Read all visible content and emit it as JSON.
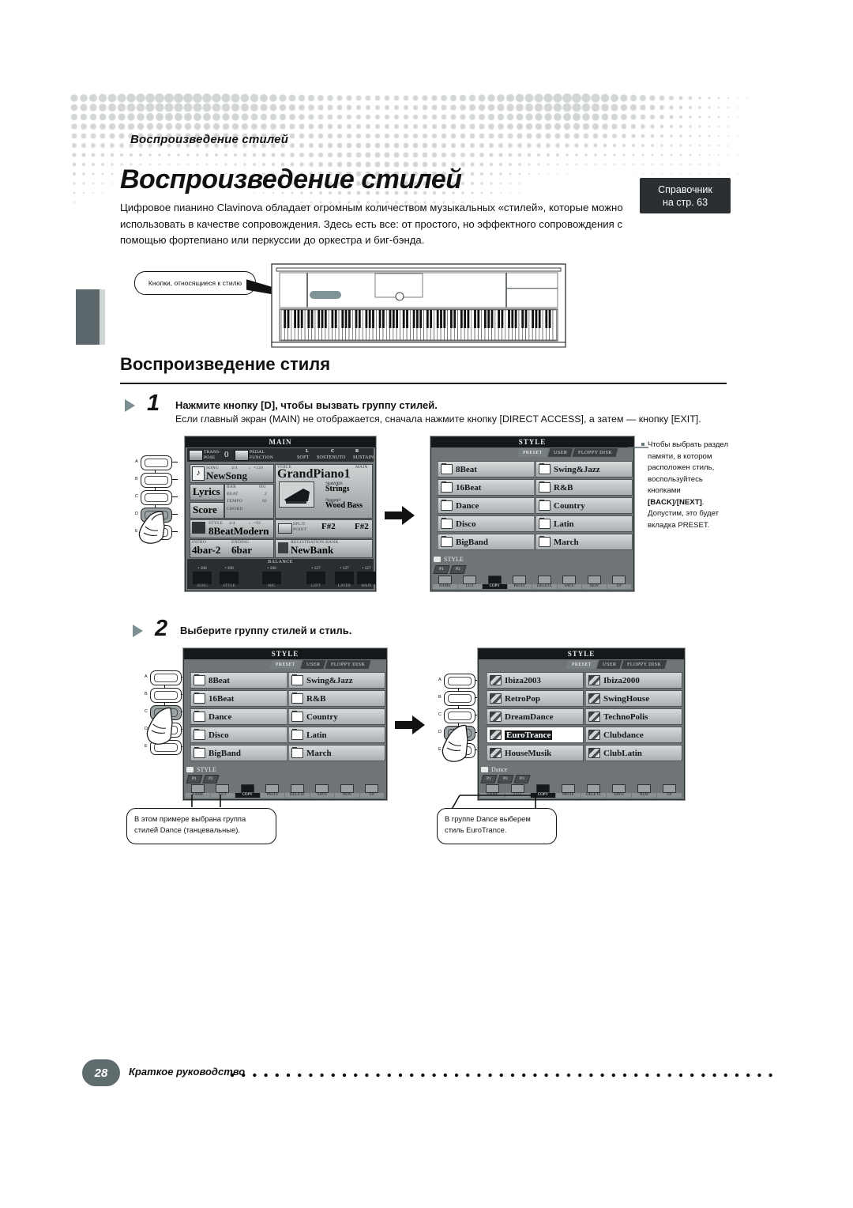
{
  "header": {
    "running_head": "Воспроизведение стилей",
    "title": "Воспроизведение стилей",
    "reference_line1": "Справочник",
    "reference_line2": "на стр. 63",
    "intro": "Цифровое пианино Clavinova обладает огромным количеством музыкальных «стилей», которые можно использовать в качестве сопровождения. Здесь есть все: от простого, но эффектного сопровождения с помощью фортепиано или перкуссии до оркестра и биг-бэнда."
  },
  "piano_callout": "Кнопки, относящиеся к стилю",
  "section_title": "Воспроизведение стиля",
  "steps": [
    {
      "number": "1",
      "title": "Нажмите кнопку [D], чтобы вызвать группу стилей.",
      "subtitle": "Если главный экран (MAIN) не отображается, сначала нажмите кнопку [DIRECT ACCESS], а затем — кнопку [EXIT]."
    },
    {
      "number": "2",
      "title": "Выберите группу стилей и стиль."
    }
  ],
  "main_screen": {
    "title": "MAIN",
    "transpose_label1": "TRANS-",
    "transpose_label2": "POSE",
    "transpose_value": "0",
    "pedal_label1": "PEDAL",
    "pedal_label2": "FUNCTION",
    "pedal_l": "L",
    "pedal_c": "C",
    "pedal_r": "R",
    "pedal_soft": "SOFT",
    "pedal_sostenuto": "SOSTENUTO",
    "pedal_sustain": "SUSTAIN",
    "song_label": "SONG",
    "song_meter": "4/4",
    "song_tempo": "♩=120",
    "song_name": "NewSong",
    "lyrics_button": "Lyrics",
    "score_button": "Score",
    "bar_label": "BAR",
    "bar_value": "001",
    "beat_label": "BEAT",
    "beat_value": "2",
    "tempo_label": "TEMPO",
    "tempo_value": "92",
    "chord_label": "CHORD",
    "style_label": "STYLE",
    "style_meter": "4/4",
    "style_tempo": "♩=92",
    "style_name": "8BeatModern",
    "intro_label": "INTRO",
    "intro_value": "4bar-2",
    "ending_label": "ENDING",
    "ending_value": "6bar",
    "voice_label": "VOICE",
    "main_label": "MAIN",
    "main_voice": "GrandPiano1",
    "layer_label": "LAYER",
    "layer_pre": "Natural!",
    "layer_voice": "Strings",
    "left_label": "LEFT",
    "left_pre": "Natural!",
    "left_voice": "Wood Bass",
    "split_label1": "SPLIT",
    "split_label2": "POINT",
    "split_left": "F#2",
    "split_right": "F#2",
    "regist_label": "REGISTRATION BANK",
    "regist_value": "NewBank",
    "balance_label": "BALANCE",
    "balance": [
      {
        "name": "SONG",
        "value": "100"
      },
      {
        "name": "STYLE",
        "value": "100"
      },
      {
        "name": "MIC",
        "value": "100"
      },
      {
        "name": "LEFT",
        "value": "127"
      },
      {
        "name": "LAYER",
        "value": "127"
      },
      {
        "name": "MAIN",
        "value": "127"
      }
    ]
  },
  "style_screen_groups": {
    "title": "STYLE",
    "tabs": [
      "PRESET",
      "USER",
      "FLOPPY DISK"
    ],
    "active_tab": "PRESET",
    "items_left": [
      "8Beat",
      "16Beat",
      "Dance",
      "Disco",
      "BigBand"
    ],
    "items_right": [
      "Swing&Jazz",
      "R&B",
      "Country",
      "Latin",
      "March"
    ],
    "folder": "STYLE",
    "page_tabs": [
      "P1",
      "P2"
    ],
    "soft_buttons": [
      "NAME",
      "CUT",
      "COPY",
      "PASTE",
      "DELETE",
      "SAVE",
      "NEW",
      "UP"
    ],
    "active_soft": "COPY"
  },
  "style_screen_dance": {
    "title": "STYLE",
    "tabs": [
      "PRESET",
      "USER",
      "FLOPPY DISK"
    ],
    "active_tab": "PRESET",
    "items_left": [
      "Ibiza2003",
      "RetroPop",
      "DreamDance",
      "EuroTrance",
      "HouseMusik"
    ],
    "items_right": [
      "Ibiza2000",
      "SwingHouse",
      "TechnoPolis",
      "Clubdance",
      "ClubLatin"
    ],
    "selected": "EuroTrance",
    "folder": "Dance",
    "page_tabs": [
      "P1",
      "P2",
      "P3"
    ],
    "soft_buttons": [
      "NAME",
      "CUT",
      "COPY",
      "PASTE",
      "DELETE",
      "SAVE",
      "NEW",
      "UP"
    ],
    "active_soft": "COPY"
  },
  "panel_buttons": {
    "letters": [
      "A",
      "B",
      "C",
      "D",
      "E"
    ],
    "step1_pressed": "D",
    "step2_left_pressed": "C",
    "step2_right_pressed": "D"
  },
  "note_step1": {
    "text_part1": "Чтобы выбрать раздел памяти, в котором расположен стиль, воспользуйтесь кнопками ",
    "bold1": "[BACK]",
    "slash": "/",
    "bold2": "[NEXT]",
    "text_part2": ". Допустим, это будет вкладка PRESET."
  },
  "callouts": {
    "left": "В этом примере выбрана группа стилей Dance (танцевальные).",
    "right": "В группе Dance выберем стиль EuroTrance."
  },
  "footer": {
    "page_number": "28",
    "title": "Краткое руководство"
  },
  "colors": {
    "accent": "#5f6c6e",
    "dark": "#2b2f32",
    "lcd_bg": "#6f7476"
  }
}
